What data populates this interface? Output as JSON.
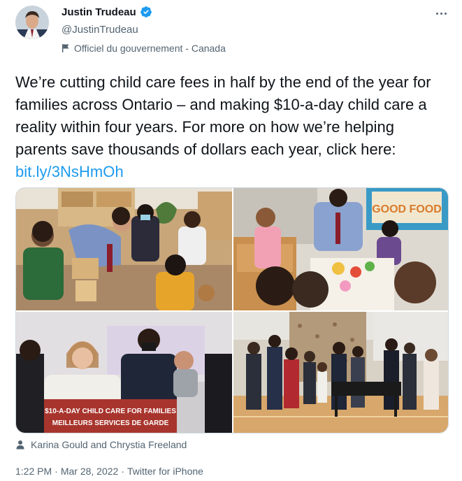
{
  "author": {
    "display_name": "Justin Trudeau",
    "handle": "@JustinTrudeau",
    "verified_icon": "verified-badge-icon",
    "government_label": "Officiel du gouvernement - Canada",
    "government_icon": "flag-icon"
  },
  "more_icon": "more-options-icon",
  "tweet": {
    "text": "We’re cutting child care fees in half by the end of the year for families across Ontario – and making $10-a-day child care a reality within four years. For more on how we’re helping parents save thousands of dollars each year, click here: ",
    "link_text": "bit.ly/3NsHmOh"
  },
  "media": {
    "photos": [
      {
        "name": "photo-1"
      },
      {
        "name": "photo-2",
        "sign_text": "GOOD FOOD"
      },
      {
        "name": "photo-3",
        "podium_line1": "$10-A-DAY CHILD CARE FOR FAMILIES",
        "podium_line2": "MEILLEURS SERVICES DE GARDE"
      },
      {
        "name": "photo-4"
      }
    ]
  },
  "tagged": {
    "icon": "person-icon",
    "text": "Karina Gould and Chrystia Freeland"
  },
  "meta": {
    "time": "1:22 PM",
    "separator1": "·",
    "date": "Mar 28, 2022",
    "separator2": "·",
    "source": "Twitter for iPhone"
  },
  "colors": {
    "accent": "#1d9bf0",
    "text_primary": "#0f1419",
    "text_secondary": "#536471",
    "border": "#cfd9de"
  }
}
